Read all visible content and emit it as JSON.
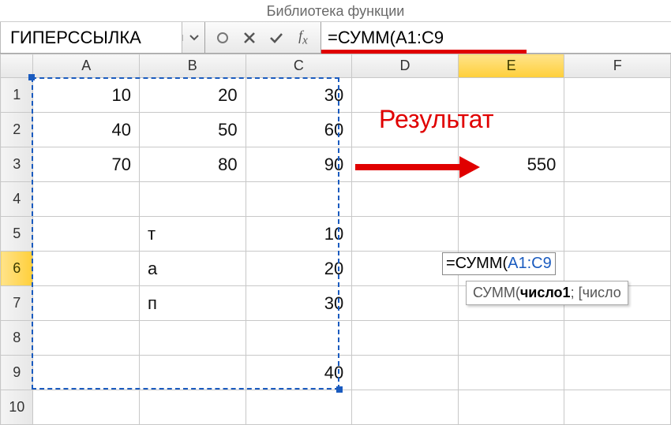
{
  "ribbon": {
    "group_label": "Библиотека функции"
  },
  "formula_bar": {
    "name_box": "ГИПЕРССЫЛКА",
    "formula": "=СУММ(A1:C9"
  },
  "columns": [
    "A",
    "B",
    "C",
    "D",
    "E",
    "F"
  ],
  "rows": [
    "1",
    "2",
    "3",
    "4",
    "5",
    "6",
    "7",
    "8",
    "9",
    "10"
  ],
  "cells": {
    "A1": "10",
    "B1": "20",
    "C1": "30",
    "A2": "40",
    "B2": "50",
    "C2": "60",
    "A3": "70",
    "B3": "80",
    "C3": "90",
    "B5": "т",
    "C5": "10",
    "B6": "а",
    "C6": "20",
    "B7": "п",
    "C7": "30",
    "C9": "40",
    "E3": "550"
  },
  "annotation": {
    "result_label": "Результат"
  },
  "inline_edit": {
    "prefix": "=СУММ(",
    "ref": "A1:C9"
  },
  "tooltip": {
    "fn": "СУММ",
    "arg1": "число1",
    "arg2": "[число"
  },
  "active": {
    "col": "E",
    "row": "6"
  }
}
